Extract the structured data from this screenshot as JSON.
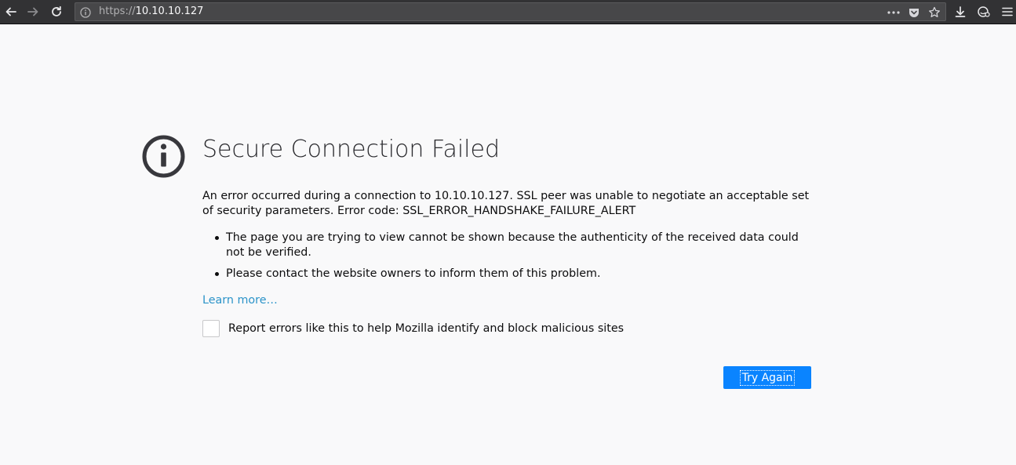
{
  "browser": {
    "url_scheme": "https://",
    "url_host": "10.10.10.127",
    "icons": [
      "back-icon",
      "forward-icon",
      "reload-icon",
      "info-icon",
      "more-icon",
      "pocket-icon",
      "bookmark-star-icon",
      "downloads-icon",
      "library-icon",
      "menu-icon"
    ]
  },
  "error": {
    "title": "Secure Connection Failed",
    "description": "An error occurred during a connection to 10.10.10.127. SSL peer was unable to negotiate an acceptable set of security parameters. Error code: SSL_ERROR_HANDSHAKE_FAILURE_ALERT",
    "bullets": [
      "The page you are trying to view cannot be shown because the authenticity of the received data could not be verified.",
      "Please contact the website owners to inform them of this problem."
    ],
    "learn_more": "Learn more…",
    "report_label": "Report errors like this to help Mozilla identify and block malicious sites",
    "report_checked": false,
    "try_again": "Try Again"
  },
  "colors": {
    "accent": "#0a84ff",
    "toolbar": "#323234",
    "page_bg": "#f9f9fa",
    "link": "#2c94c9"
  }
}
